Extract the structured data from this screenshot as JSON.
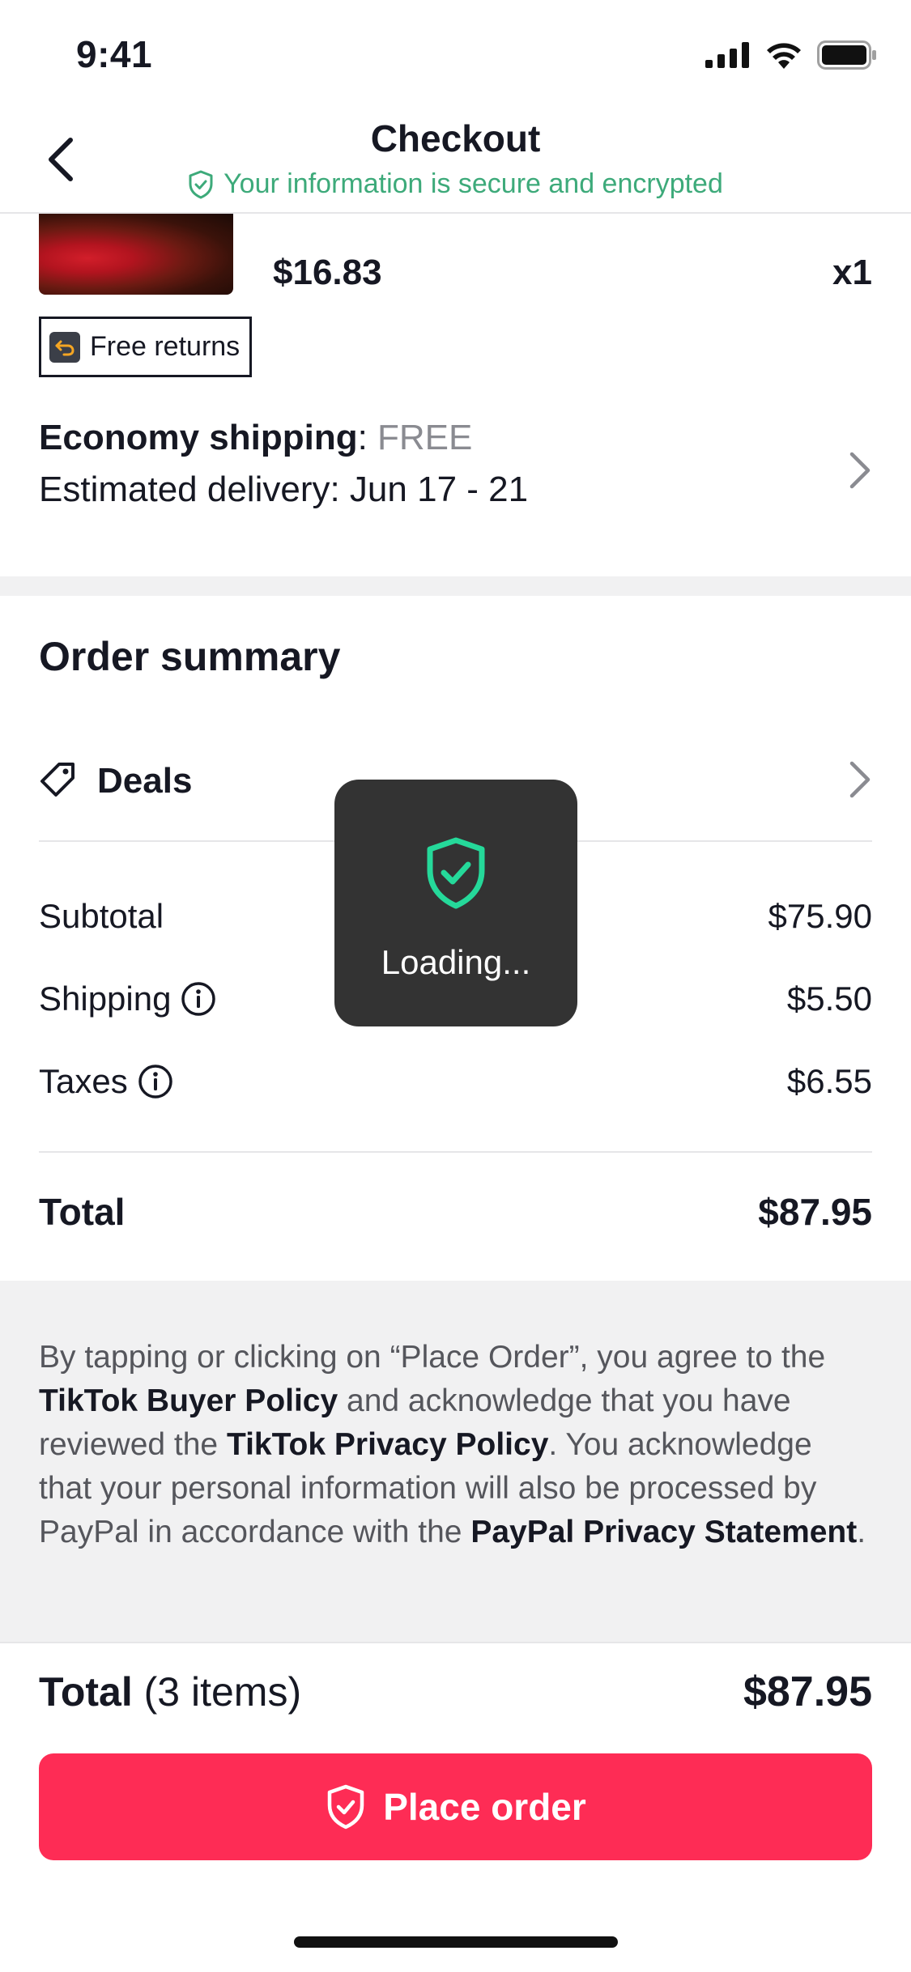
{
  "status_bar": {
    "time": "9:41"
  },
  "header": {
    "title": "Checkout",
    "secure_text": "Your information is secure and encrypted"
  },
  "product": {
    "price": "$16.83",
    "quantity": "x1",
    "badge": "Free returns"
  },
  "shipping": {
    "label": "Economy shipping",
    "separator": ": ",
    "price": "FREE",
    "delivery": "Estimated delivery: Jun 17 - 21"
  },
  "order_summary": {
    "title": "Order summary",
    "deals_label": "Deals",
    "subtotal_label": "Subtotal",
    "subtotal_value": "$75.90",
    "shipping_label": "Shipping",
    "shipping_value": "$5.50",
    "taxes_label": "Taxes",
    "taxes_value": "$6.55",
    "total_label": "Total",
    "total_value": "$87.95"
  },
  "legal": {
    "t1": "By tapping or clicking on “Place Order”, you agree to the ",
    "link1": "TikTok Buyer Policy",
    "t2": " and acknowledge that you have reviewed the ",
    "link2": "TikTok Privacy Policy",
    "t3": ". You acknowledge that your personal information will also be processed by PayPal in accordance with the ",
    "link3": "PayPal Privacy Statement",
    "t4": "."
  },
  "footer": {
    "total_label": "Total",
    "items_count": "(3 items)",
    "total_value": "$87.95",
    "place_order": "Place order"
  },
  "toast": {
    "text": "Loading..."
  },
  "colors": {
    "accent": "#fe2c55",
    "secure_green": "#3daa7a",
    "toast_bg": "#333333",
    "toast_icon": "#25d99a"
  }
}
